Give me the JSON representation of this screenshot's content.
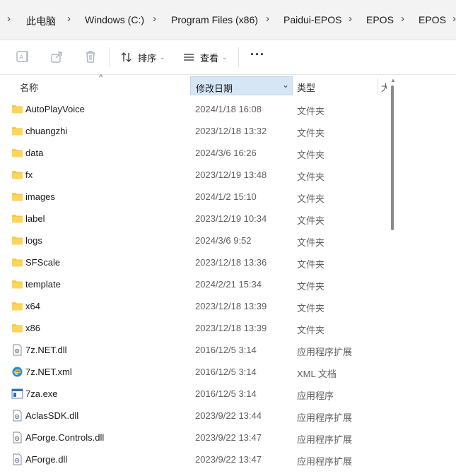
{
  "breadcrumb": {
    "items": [
      "此电脑",
      "Windows (C:)",
      "Program Files (x86)",
      "Paidui-EPOS",
      "EPOS",
      "EPOS"
    ]
  },
  "toolbar": {
    "sort_label": "排序",
    "view_label": "查看",
    "more_label": "···",
    "icons": [
      "rename-icon",
      "share-icon",
      "delete-icon",
      "sort-icon",
      "view-icon",
      "more-icon"
    ]
  },
  "columns": {
    "name": "名称",
    "date": "修改日期",
    "type": "类型",
    "size": "大"
  },
  "files": [
    {
      "name": "AutoPlayVoice",
      "date": "2024/1/18 16:08",
      "type": "文件夹",
      "icon": "folder"
    },
    {
      "name": "chuangzhi",
      "date": "2023/12/18 13:32",
      "type": "文件夹",
      "icon": "folder"
    },
    {
      "name": "data",
      "date": "2024/3/6 16:26",
      "type": "文件夹",
      "icon": "folder"
    },
    {
      "name": "fx",
      "date": "2023/12/19 13:48",
      "type": "文件夹",
      "icon": "folder"
    },
    {
      "name": "images",
      "date": "2024/1/2 15:10",
      "type": "文件夹",
      "icon": "folder"
    },
    {
      "name": "label",
      "date": "2023/12/19 10:34",
      "type": "文件夹",
      "icon": "folder"
    },
    {
      "name": "logs",
      "date": "2024/3/6 9:52",
      "type": "文件夹",
      "icon": "folder"
    },
    {
      "name": "SFScale",
      "date": "2023/12/18 13:36",
      "type": "文件夹",
      "icon": "folder"
    },
    {
      "name": "template",
      "date": "2024/2/21 15:34",
      "type": "文件夹",
      "icon": "folder"
    },
    {
      "name": "x64",
      "date": "2023/12/18 13:39",
      "type": "文件夹",
      "icon": "folder"
    },
    {
      "name": "x86",
      "date": "2023/12/18 13:39",
      "type": "文件夹",
      "icon": "folder"
    },
    {
      "name": "7z.NET.dll",
      "date": "2016/12/5 3:14",
      "type": "应用程序扩展",
      "icon": "dll"
    },
    {
      "name": "7z.NET.xml",
      "date": "2016/12/5 3:14",
      "type": "XML 文档",
      "icon": "xml"
    },
    {
      "name": "7za.exe",
      "date": "2016/12/5 3:14",
      "type": "应用程序",
      "icon": "exe"
    },
    {
      "name": "AclasSDK.dll",
      "date": "2023/9/22 13:44",
      "type": "应用程序扩展",
      "icon": "dll"
    },
    {
      "name": "AForge.Controls.dll",
      "date": "2023/9/22 13:47",
      "type": "应用程序扩展",
      "icon": "dll"
    },
    {
      "name": "AForge.dll",
      "date": "2023/9/22 13:47",
      "type": "应用程序扩展",
      "icon": "dll"
    }
  ],
  "colors": {
    "folder": "#f8c93f",
    "selected_header": "#d7e6f5",
    "accent": "#0a64c8"
  }
}
